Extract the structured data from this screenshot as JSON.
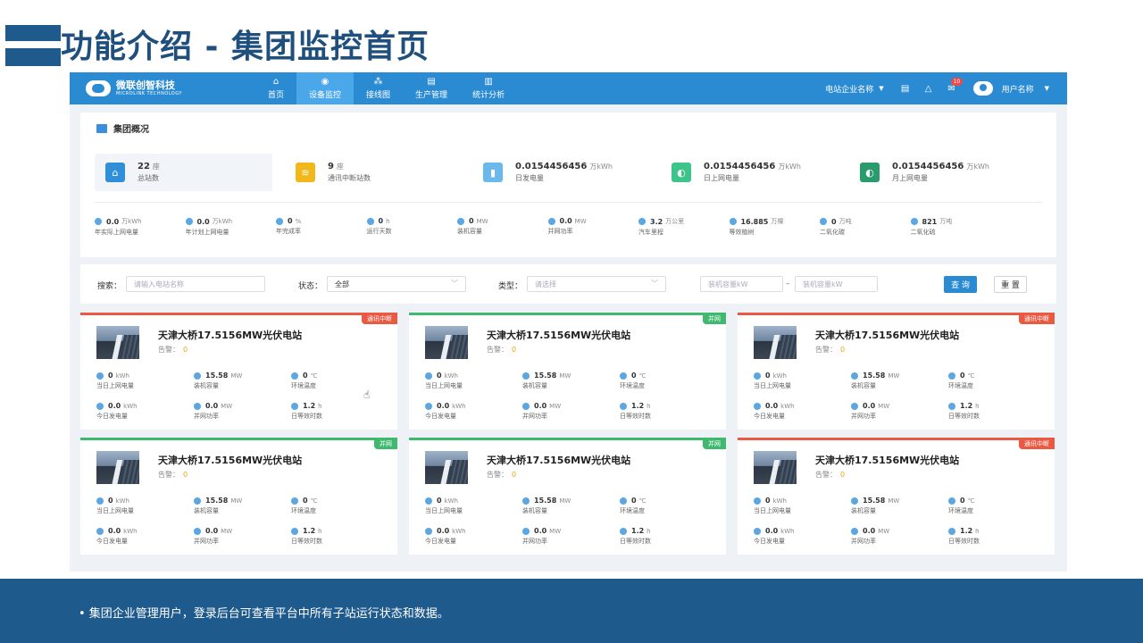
{
  "slide": {
    "title": "功能介绍 - 集团监控首页",
    "footer_text": "•  集团企业管理用户，登录后台可查看平台中所有子站运行状态和数据。"
  },
  "topnav": {
    "logo_name": "微联创智科技",
    "logo_sub": "MICROLINK TECHNOLOGY",
    "items": [
      {
        "label": "首页",
        "icon": "home-icon",
        "active": false
      },
      {
        "label": "设备监控",
        "icon": "monitor-icon",
        "active": true
      },
      {
        "label": "接线图",
        "icon": "wiring-icon",
        "active": false
      },
      {
        "label": "生产管理",
        "icon": "production-icon",
        "active": false
      },
      {
        "label": "统计分析",
        "icon": "chart-icon",
        "active": false
      }
    ],
    "company_label": "电站企业名称",
    "notification_count": "10",
    "user_label": "用户名称"
  },
  "overview": {
    "title": "集团概况",
    "cards": [
      {
        "value": "22",
        "unit": "座",
        "label": "总站数",
        "color": "#2f8fd8",
        "icon": "home-icon"
      },
      {
        "value": "9",
        "unit": "座",
        "label": "通讯中断站数",
        "color": "#f2b71a",
        "icon": "wifi-off-icon"
      },
      {
        "value": "0.0154456456",
        "unit": "万kWh",
        "label": "日发电量",
        "color": "#6ab9ea",
        "icon": "battery-icon"
      },
      {
        "value": "0.0154456456",
        "unit": "万kWh",
        "label": "日上网电量",
        "color": "#3cc48a",
        "icon": "grid-energy-icon"
      },
      {
        "value": "0.0154456456",
        "unit": "万kWh",
        "label": "月上网电量",
        "color": "#2a9b6d",
        "icon": "grid-energy-icon"
      }
    ],
    "mini_stats": [
      {
        "value": "0.0",
        "unit": "万kWh",
        "label": "年实际上网电量"
      },
      {
        "value": "0.0",
        "unit": "万kWh",
        "label": "年计划上网电量"
      },
      {
        "value": "0",
        "unit": "%",
        "label": "年完成率"
      },
      {
        "value": "0",
        "unit": "h",
        "label": "运行天数"
      },
      {
        "value": "0",
        "unit": "MW",
        "label": "装机容量"
      },
      {
        "value": "0.0",
        "unit": "MW",
        "label": "并网功率"
      },
      {
        "value": "3.2",
        "unit": "万公里",
        "label": "汽车里程"
      },
      {
        "value": "16.885",
        "unit": "万棵",
        "label": "等效植树"
      },
      {
        "value": "0",
        "unit": "万吨",
        "label": "二氧化碳"
      },
      {
        "value": "821",
        "unit": "万吨",
        "label": "二氧化硫"
      }
    ]
  },
  "filter": {
    "search_label": "搜索：",
    "search_placeholder": "请输入电站名称",
    "status_label": "状态：",
    "status_value": "全部",
    "type_label": "类型：",
    "type_placeholder": "请选择",
    "cap_min_placeholder": "装机容量kW",
    "cap_max_placeholder": "装机容量kW",
    "range_sep": "–",
    "query_button": "查 询",
    "reset_button": "重 置"
  },
  "stations": [
    {
      "name": "天津大桥17.5156MW光伏电站",
      "status": "通讯中断",
      "state": "offline"
    },
    {
      "name": "天津大桥17.5156MW光伏电站",
      "status": "并网",
      "state": "online"
    },
    {
      "name": "天津大桥17.5156MW光伏电站",
      "status": "通讯中断",
      "state": "offline"
    },
    {
      "name": "天津大桥17.5156MW光伏电站",
      "status": "并网",
      "state": "online"
    },
    {
      "name": "天津大桥17.5156MW光伏电站",
      "status": "并网",
      "state": "online"
    },
    {
      "name": "天津大桥17.5156MW光伏电站",
      "status": "通讯中断",
      "state": "offline"
    }
  ],
  "station_common": {
    "alarm_label": "告警：",
    "alarm_value": "0",
    "stats": [
      {
        "value": "0",
        "unit": "kWh",
        "label": "当日上网电量"
      },
      {
        "value": "15.58",
        "unit": "MW",
        "label": "装机容量"
      },
      {
        "value": "0",
        "unit": "℃",
        "label": "环境温度"
      },
      {
        "value": "0.0",
        "unit": "kWh",
        "label": "今日发电量"
      },
      {
        "value": "0.0",
        "unit": "MW",
        "label": "并网功率"
      },
      {
        "value": "1.2",
        "unit": "h",
        "label": "日等效时数"
      }
    ]
  }
}
